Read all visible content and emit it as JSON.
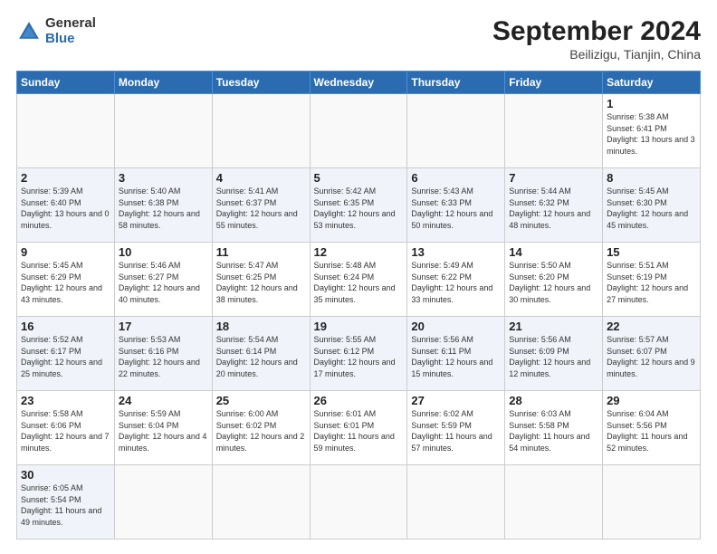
{
  "header": {
    "logo_general": "General",
    "logo_blue": "Blue",
    "month_title": "September 2024",
    "location": "Beilizigu, Tianjin, China"
  },
  "calendar": {
    "days_of_week": [
      "Sunday",
      "Monday",
      "Tuesday",
      "Wednesday",
      "Thursday",
      "Friday",
      "Saturday"
    ],
    "weeks": [
      [
        null,
        null,
        null,
        null,
        null,
        null,
        {
          "day": 1,
          "sunrise": "Sunrise: 5:38 AM",
          "sunset": "Sunset: 6:41 PM",
          "daylight": "Daylight: 13 hours and 3 minutes."
        }
      ],
      [
        {
          "day": 2,
          "sunrise": "Sunrise: 5:39 AM",
          "sunset": "Sunset: 6:40 PM",
          "daylight": "Daylight: 13 hours and 0 minutes."
        },
        {
          "day": 3,
          "sunrise": "Sunrise: 5:40 AM",
          "sunset": "Sunset: 6:38 PM",
          "daylight": "Daylight: 12 hours and 58 minutes."
        },
        {
          "day": 4,
          "sunrise": "Sunrise: 5:41 AM",
          "sunset": "Sunset: 6:37 PM",
          "daylight": "Daylight: 12 hours and 55 minutes."
        },
        {
          "day": 5,
          "sunrise": "Sunrise: 5:42 AM",
          "sunset": "Sunset: 6:35 PM",
          "daylight": "Daylight: 12 hours and 53 minutes."
        },
        {
          "day": 6,
          "sunrise": "Sunrise: 5:43 AM",
          "sunset": "Sunset: 6:33 PM",
          "daylight": "Daylight: 12 hours and 50 minutes."
        },
        {
          "day": 7,
          "sunrise": "Sunrise: 5:44 AM",
          "sunset": "Sunset: 6:32 PM",
          "daylight": "Daylight: 12 hours and 48 minutes."
        },
        {
          "day": 8,
          "sunrise": "Sunrise: 5:45 AM",
          "sunset": "Sunset: 6:30 PM",
          "daylight": "Daylight: 12 hours and 45 minutes."
        }
      ],
      [
        {
          "day": 9,
          "sunrise": "Sunrise: 5:45 AM",
          "sunset": "Sunset: 6:29 PM",
          "daylight": "Daylight: 12 hours and 43 minutes."
        },
        {
          "day": 10,
          "sunrise": "Sunrise: 5:46 AM",
          "sunset": "Sunset: 6:27 PM",
          "daylight": "Daylight: 12 hours and 40 minutes."
        },
        {
          "day": 11,
          "sunrise": "Sunrise: 5:47 AM",
          "sunset": "Sunset: 6:25 PM",
          "daylight": "Daylight: 12 hours and 38 minutes."
        },
        {
          "day": 12,
          "sunrise": "Sunrise: 5:48 AM",
          "sunset": "Sunset: 6:24 PM",
          "daylight": "Daylight: 12 hours and 35 minutes."
        },
        {
          "day": 13,
          "sunrise": "Sunrise: 5:49 AM",
          "sunset": "Sunset: 6:22 PM",
          "daylight": "Daylight: 12 hours and 33 minutes."
        },
        {
          "day": 14,
          "sunrise": "Sunrise: 5:50 AM",
          "sunset": "Sunset: 6:20 PM",
          "daylight": "Daylight: 12 hours and 30 minutes."
        },
        {
          "day": 15,
          "sunrise": "Sunrise: 5:51 AM",
          "sunset": "Sunset: 6:19 PM",
          "daylight": "Daylight: 12 hours and 27 minutes."
        }
      ],
      [
        {
          "day": 16,
          "sunrise": "Sunrise: 5:52 AM",
          "sunset": "Sunset: 6:17 PM",
          "daylight": "Daylight: 12 hours and 25 minutes."
        },
        {
          "day": 17,
          "sunrise": "Sunrise: 5:53 AM",
          "sunset": "Sunset: 6:16 PM",
          "daylight": "Daylight: 12 hours and 22 minutes."
        },
        {
          "day": 18,
          "sunrise": "Sunrise: 5:54 AM",
          "sunset": "Sunset: 6:14 PM",
          "daylight": "Daylight: 12 hours and 20 minutes."
        },
        {
          "day": 19,
          "sunrise": "Sunrise: 5:55 AM",
          "sunset": "Sunset: 6:12 PM",
          "daylight": "Daylight: 12 hours and 17 minutes."
        },
        {
          "day": 20,
          "sunrise": "Sunrise: 5:56 AM",
          "sunset": "Sunset: 6:11 PM",
          "daylight": "Daylight: 12 hours and 15 minutes."
        },
        {
          "day": 21,
          "sunrise": "Sunrise: 5:56 AM",
          "sunset": "Sunset: 6:09 PM",
          "daylight": "Daylight: 12 hours and 12 minutes."
        },
        {
          "day": 22,
          "sunrise": "Sunrise: 5:57 AM",
          "sunset": "Sunset: 6:07 PM",
          "daylight": "Daylight: 12 hours and 9 minutes."
        }
      ],
      [
        {
          "day": 23,
          "sunrise": "Sunrise: 5:58 AM",
          "sunset": "Sunset: 6:06 PM",
          "daylight": "Daylight: 12 hours and 7 minutes."
        },
        {
          "day": 24,
          "sunrise": "Sunrise: 5:59 AM",
          "sunset": "Sunset: 6:04 PM",
          "daylight": "Daylight: 12 hours and 4 minutes."
        },
        {
          "day": 25,
          "sunrise": "Sunrise: 6:00 AM",
          "sunset": "Sunset: 6:02 PM",
          "daylight": "Daylight: 12 hours and 2 minutes."
        },
        {
          "day": 26,
          "sunrise": "Sunrise: 6:01 AM",
          "sunset": "Sunset: 6:01 PM",
          "daylight": "Daylight: 11 hours and 59 minutes."
        },
        {
          "day": 27,
          "sunrise": "Sunrise: 6:02 AM",
          "sunset": "Sunset: 5:59 PM",
          "daylight": "Daylight: 11 hours and 57 minutes."
        },
        {
          "day": 28,
          "sunrise": "Sunrise: 6:03 AM",
          "sunset": "Sunset: 5:58 PM",
          "daylight": "Daylight: 11 hours and 54 minutes."
        },
        {
          "day": 29,
          "sunrise": "Sunrise: 6:04 AM",
          "sunset": "Sunset: 5:56 PM",
          "daylight": "Daylight: 11 hours and 52 minutes."
        }
      ],
      [
        {
          "day": 30,
          "sunrise": "Sunrise: 6:05 AM",
          "sunset": "Sunset: 5:54 PM",
          "daylight": "Daylight: 11 hours and 49 minutes."
        },
        null,
        null,
        null,
        null,
        null,
        null
      ]
    ]
  }
}
